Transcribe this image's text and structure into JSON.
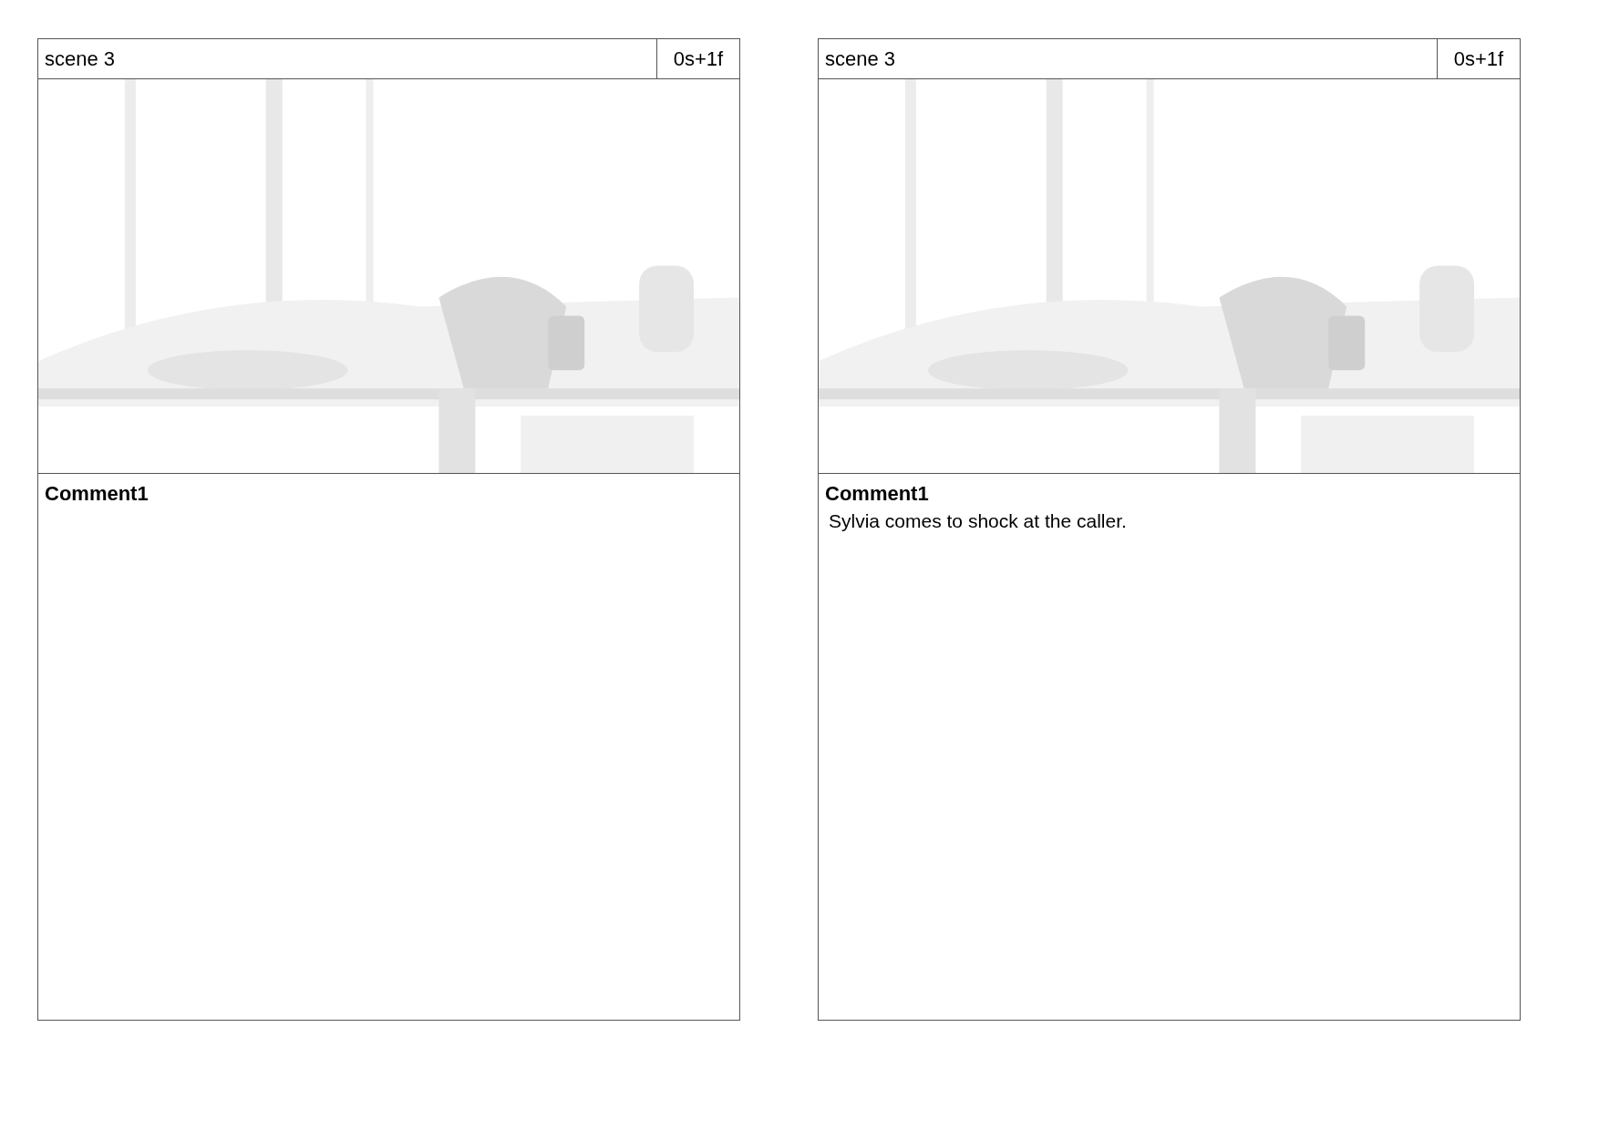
{
  "panels": [
    {
      "scene": "scene 3",
      "time": "0s+1f",
      "comment_title": "Comment1"
    },
    {
      "scene": "scene 3",
      "time": "0s+1f",
      "comment_title": "Comment1",
      "comment": "Sylvia comes to shock at the caller."
    }
  ]
}
